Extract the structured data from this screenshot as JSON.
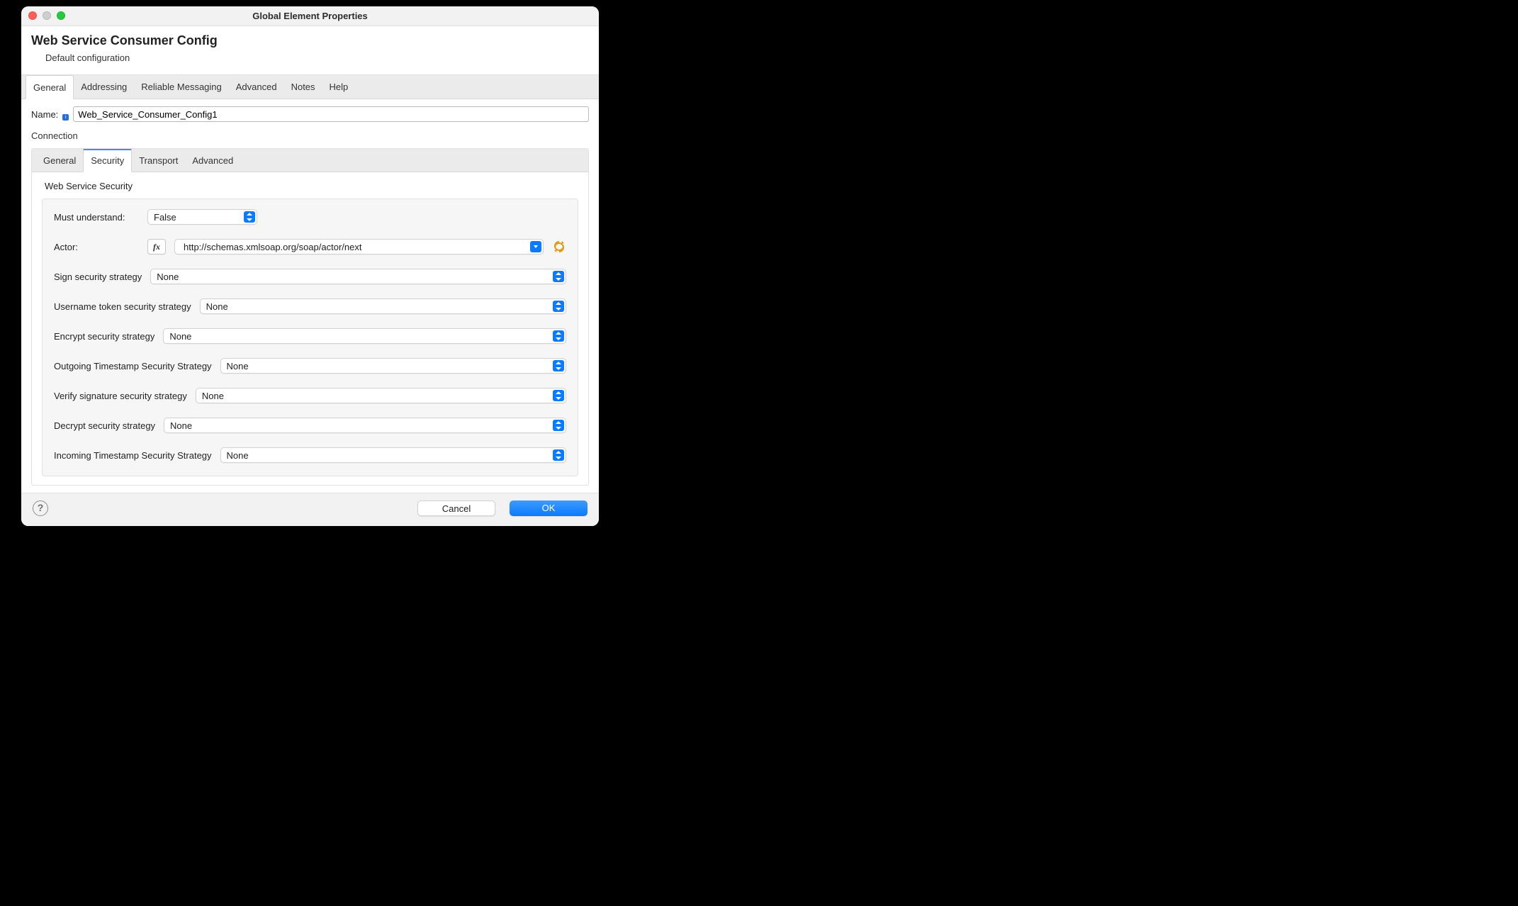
{
  "window": {
    "title": "Global Element Properties"
  },
  "header": {
    "title": "Web Service Consumer Config",
    "subtitle": "Default configuration"
  },
  "tabs": {
    "items": [
      "General",
      "Addressing",
      "Reliable Messaging",
      "Advanced",
      "Notes",
      "Help"
    ],
    "active_index": 0
  },
  "name_row": {
    "label": "Name:",
    "value": "Web_Service_Consumer_Config1"
  },
  "connection_label": "Connection",
  "inner_tabs": {
    "items": [
      "General",
      "Security",
      "Transport",
      "Advanced"
    ],
    "active_index": 1
  },
  "security": {
    "group_label": "Web Service Security",
    "must_understand": {
      "label": "Must understand:",
      "value": "False"
    },
    "actor": {
      "label": "Actor:",
      "fx": "fx",
      "value": "http://schemas.xmlsoap.org/soap/actor/next"
    },
    "sign": {
      "label": "Sign security strategy",
      "value": "None"
    },
    "username": {
      "label": "Username token security strategy",
      "value": "None"
    },
    "encrypt": {
      "label": "Encrypt security strategy",
      "value": "None"
    },
    "out_ts": {
      "label": "Outgoing Timestamp Security Strategy",
      "value": "None"
    },
    "verify": {
      "label": "Verify signature security strategy",
      "value": "None"
    },
    "decrypt": {
      "label": "Decrypt security strategy",
      "value": "None"
    },
    "in_ts": {
      "label": "Incoming Timestamp Security Strategy",
      "value": "None"
    }
  },
  "footer": {
    "cancel": "Cancel",
    "ok": "OK"
  }
}
